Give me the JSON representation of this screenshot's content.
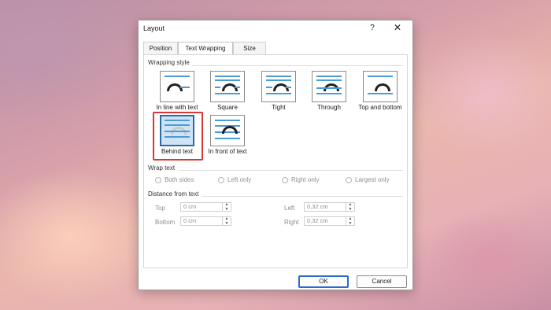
{
  "window": {
    "title": "Layout",
    "help": "?",
    "close": "✕"
  },
  "tabs": [
    "Position",
    "Text Wrapping",
    "Size"
  ],
  "wrapping_style": {
    "label": "Wrapping style",
    "options": [
      {
        "label": "In line with text"
      },
      {
        "label": "Square"
      },
      {
        "label": "Tight"
      },
      {
        "label": "Through"
      },
      {
        "label": "Top and bottom"
      },
      {
        "label": "Behind text",
        "selected": true
      },
      {
        "label": "In front of text"
      }
    ]
  },
  "wrap_text": {
    "label": "Wrap text",
    "options": [
      "Both sides",
      "Left only",
      "Right only",
      "Largest only"
    ]
  },
  "distance": {
    "label": "Distance from text",
    "top_label": "Top",
    "top_value": "0 cm",
    "bottom_label": "Bottom",
    "bottom_value": "0 cm",
    "left_label": "Left",
    "left_value": "0,32 cm",
    "right_label": "Right",
    "right_value": "0,32 cm"
  },
  "buttons": {
    "ok": "OK",
    "cancel": "Cancel"
  },
  "colors": {
    "accent": "#2c6aa6",
    "highlight": "#d93636",
    "line_blue": "#4a9cd6"
  }
}
